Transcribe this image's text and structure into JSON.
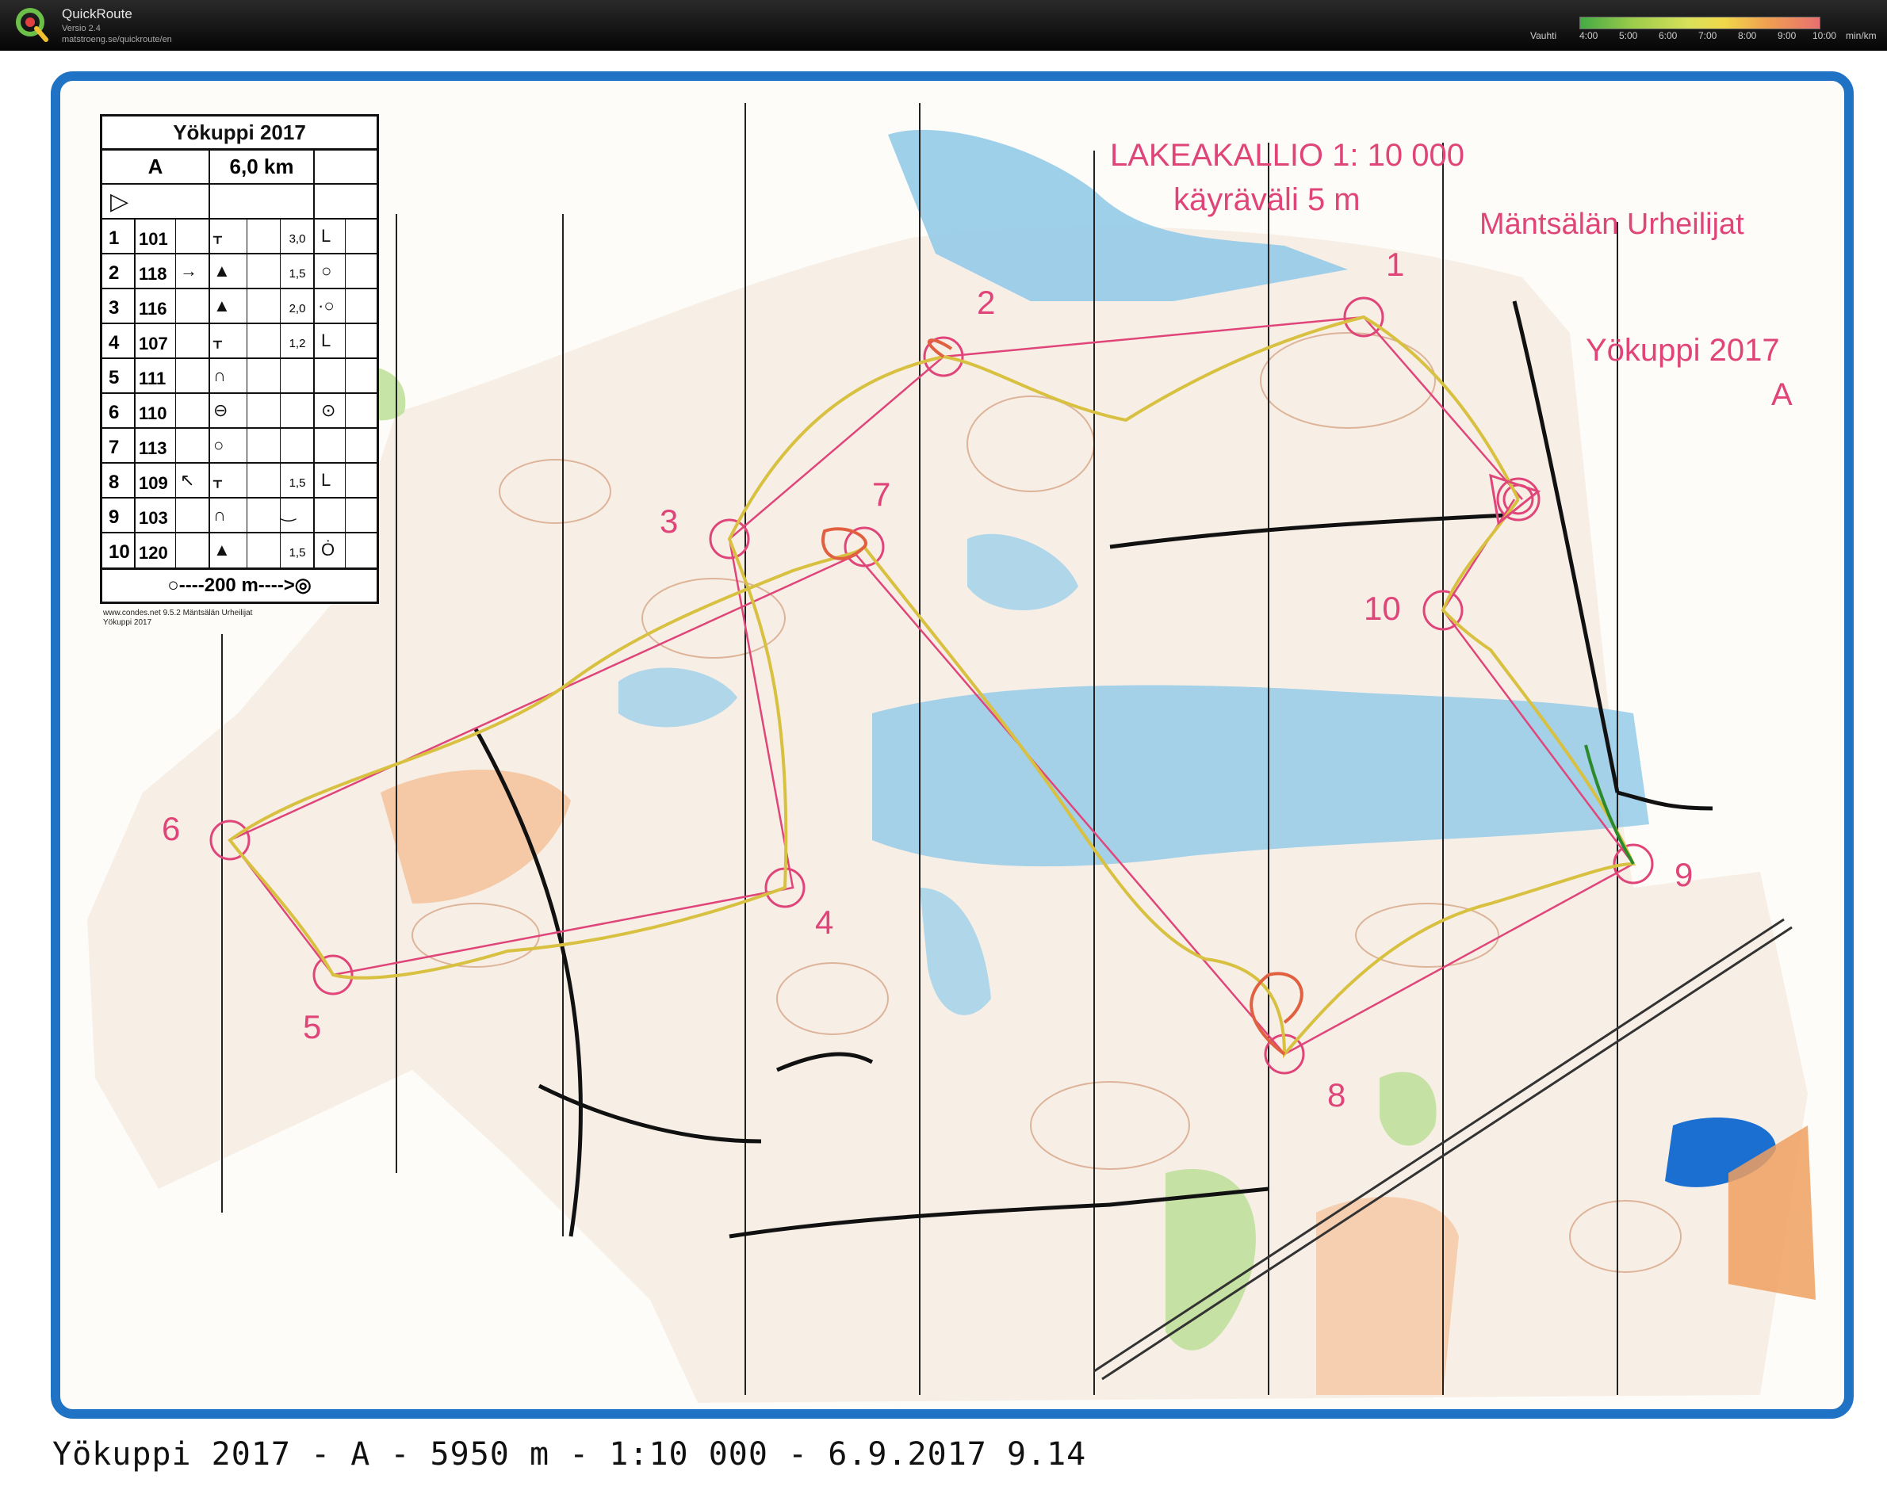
{
  "app": {
    "name": "QuickRoute",
    "version": "Versio 2.4",
    "url": "matstroeng.se/quickroute/en"
  },
  "pace_legend": {
    "label": "Vauhti",
    "ticks": [
      "4:00",
      "5:00",
      "6:00",
      "7:00",
      "8:00",
      "9:00",
      "10:00"
    ],
    "unit": "min/km",
    "colors": [
      "#44aa44",
      "#9ccc4a",
      "#d8e05a",
      "#f0d84a",
      "#f0a050",
      "#e87070"
    ]
  },
  "map": {
    "title": "LAKEAKALLIO 1: 10 000",
    "contour": "käyräväli 5 m",
    "club": "Mäntsälän Urheilijat",
    "event": "Yökuppi 2017",
    "class": "A",
    "frame_color": "#1f72c4",
    "course_color": "#e0457a",
    "route_color": "#d8c040"
  },
  "control_description": {
    "title": "Yökuppi 2017",
    "class": "A",
    "length": "6,0 km",
    "start_symbol": "▷",
    "rows": [
      {
        "n": "1",
        "code": "101",
        "dir": "",
        "feature": "ᚁ",
        "dim": "3,0",
        "extra": "L"
      },
      {
        "n": "2",
        "code": "118",
        "dir": "→",
        "feature": "▲",
        "dim": "1,5",
        "extra": "○"
      },
      {
        "n": "3",
        "code": "116",
        "dir": "",
        "feature": "▲",
        "dim": "2,0",
        "extra": "·○"
      },
      {
        "n": "4",
        "code": "107",
        "dir": "",
        "feature": "ᚁ",
        "dim": "1,2",
        "extra": "L"
      },
      {
        "n": "5",
        "code": "111",
        "dir": "",
        "feature": "∩",
        "dim": "",
        "extra": ""
      },
      {
        "n": "6",
        "code": "110",
        "dir": "",
        "feature": "⊖",
        "dim": "",
        "extra": "⊙"
      },
      {
        "n": "7",
        "code": "113",
        "dir": "",
        "feature": "○",
        "dim": "",
        "extra": ""
      },
      {
        "n": "8",
        "code": "109",
        "dir": "↖",
        "feature": "ᚁ",
        "dim": "1,5",
        "extra": "L"
      },
      {
        "n": "9",
        "code": "103",
        "dir": "",
        "feature": "∩",
        "dim": "",
        "extra": "‿"
      },
      {
        "n": "10",
        "code": "120",
        "dir": "",
        "feature": "▲",
        "dim": "1,5",
        "extra": "Ȯ"
      }
    ],
    "finish": "○----200 m---->◎",
    "footnote_1": "www.condes.net 9.5.2 Mäntsälän Urheilijat",
    "footnote_2": "Yökuppi 2017"
  },
  "control_labels": [
    "1",
    "2",
    "3",
    "4",
    "5",
    "6",
    "7",
    "8",
    "9",
    "10"
  ],
  "caption": "Yökuppi 2017 - A - 5950 m - 1:10 000 - 6.9.2017 9.14"
}
